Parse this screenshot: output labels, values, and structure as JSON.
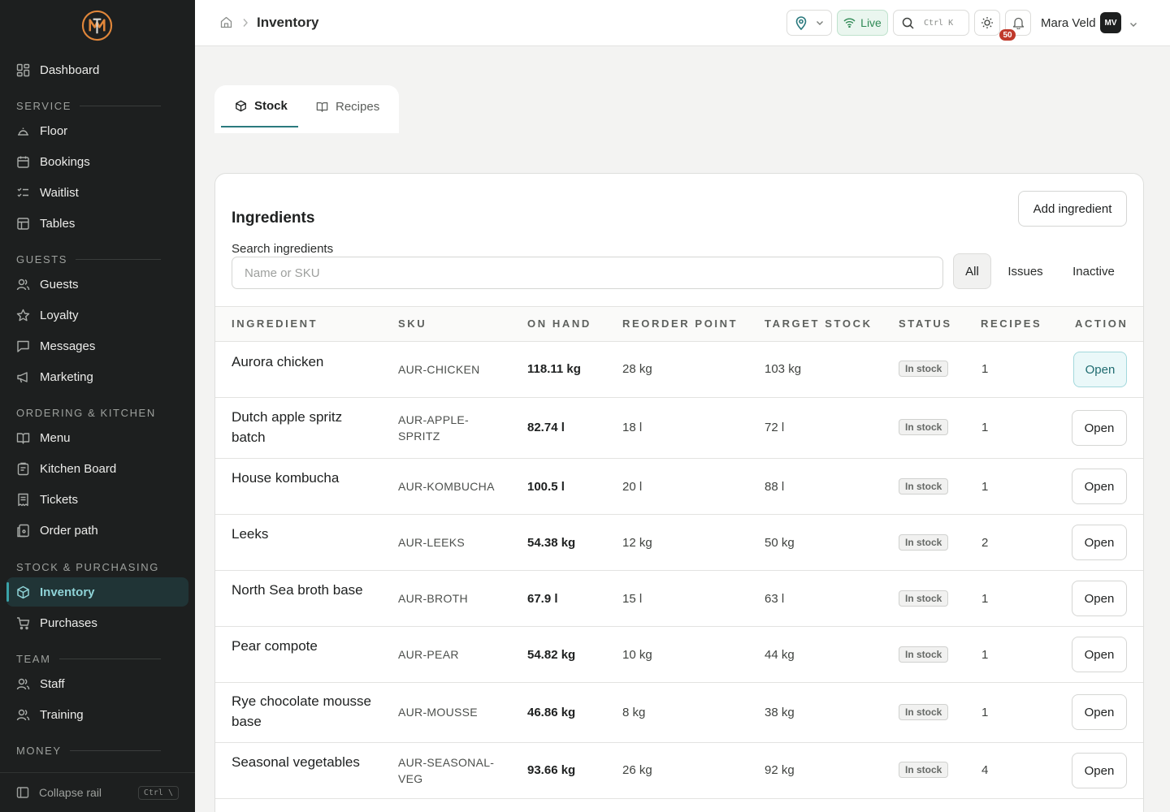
{
  "sidebar": {
    "dashboard": "Dashboard",
    "sections": {
      "service": "SERVICE",
      "guests": "GUESTS",
      "ordering": "ORDERING & KITCHEN",
      "stock": "STOCK & PURCHASING",
      "team": "TEAM",
      "money": "MONEY"
    },
    "items": {
      "floor": "Floor",
      "bookings": "Bookings",
      "waitlist": "Waitlist",
      "tables": "Tables",
      "guests": "Guests",
      "loyalty": "Loyalty",
      "messages": "Messages",
      "marketing": "Marketing",
      "menu": "Menu",
      "kitchen_board": "Kitchen Board",
      "tickets": "Tickets",
      "order_path": "Order path",
      "inventory": "Inventory",
      "purchases": "Purchases",
      "staff": "Staff",
      "training": "Training"
    },
    "collapse_label": "Collapse rail",
    "collapse_shortcut": "Ctrl \\"
  },
  "topbar": {
    "title": "Inventory",
    "live_label": "Live",
    "search_shortcut": "Ctrl K",
    "notification_count": "50",
    "user_name": "Mara Veld",
    "user_initials": "MV"
  },
  "tabs": {
    "stock": "Stock",
    "recipes": "Recipes"
  },
  "panel": {
    "title": "Ingredients",
    "add_button": "Add ingredient",
    "search_label": "Search ingredients",
    "search_placeholder": "Name or SKU",
    "search_value": "",
    "filters": {
      "all": "All",
      "issues": "Issues",
      "inactive": "Inactive"
    }
  },
  "table": {
    "headers": {
      "ingredient": "INGREDIENT",
      "sku": "SKU",
      "on_hand": "ON HAND",
      "reorder_point": "REORDER POINT",
      "target_stock": "TARGET STOCK",
      "status": "STATUS",
      "recipes": "RECIPES",
      "action": "ACTION"
    },
    "rows": [
      {
        "name": "Aurora chicken",
        "sku": "AUR-CHICKEN",
        "on_hand": "118.11 kg",
        "reorder": "28 kg",
        "target": "103 kg",
        "status": "In stock",
        "recipes": "1",
        "action": "Open"
      },
      {
        "name": "Dutch apple spritz batch",
        "sku": "AUR-APPLE-SPRITZ",
        "on_hand": "82.74 l",
        "reorder": "18 l",
        "target": "72 l",
        "status": "In stock",
        "recipes": "1",
        "action": "Open"
      },
      {
        "name": "House kombucha",
        "sku": "AUR-KOMBUCHA",
        "on_hand": "100.5 l",
        "reorder": "20 l",
        "target": "88 l",
        "status": "In stock",
        "recipes": "1",
        "action": "Open"
      },
      {
        "name": "Leeks",
        "sku": "AUR-LEEKS",
        "on_hand": "54.38 kg",
        "reorder": "12 kg",
        "target": "50 kg",
        "status": "In stock",
        "recipes": "2",
        "action": "Open"
      },
      {
        "name": "North Sea broth base",
        "sku": "AUR-BROTH",
        "on_hand": "67.9 l",
        "reorder": "15 l",
        "target": "63 l",
        "status": "In stock",
        "recipes": "1",
        "action": "Open"
      },
      {
        "name": "Pear compote",
        "sku": "AUR-PEAR",
        "on_hand": "54.82 kg",
        "reorder": "10 kg",
        "target": "44 kg",
        "status": "In stock",
        "recipes": "1",
        "action": "Open"
      },
      {
        "name": "Rye chocolate mousse base",
        "sku": "AUR-MOUSSE",
        "on_hand": "46.86 kg",
        "reorder": "8 kg",
        "target": "38 kg",
        "status": "In stock",
        "recipes": "1",
        "action": "Open"
      },
      {
        "name": "Seasonal vegetables",
        "sku": "AUR-SEASONAL-VEG",
        "on_hand": "93.66 kg",
        "reorder": "26 kg",
        "target": "92 kg",
        "status": "In stock",
        "recipes": "4",
        "action": "Open"
      }
    ]
  },
  "colors": {
    "sidebar_bg": "#1d1f1f",
    "accent_teal": "#2b7a7e",
    "live_green": "#2f8a55",
    "badge_red": "#c0392b",
    "logo_orange": "#e0863a"
  }
}
